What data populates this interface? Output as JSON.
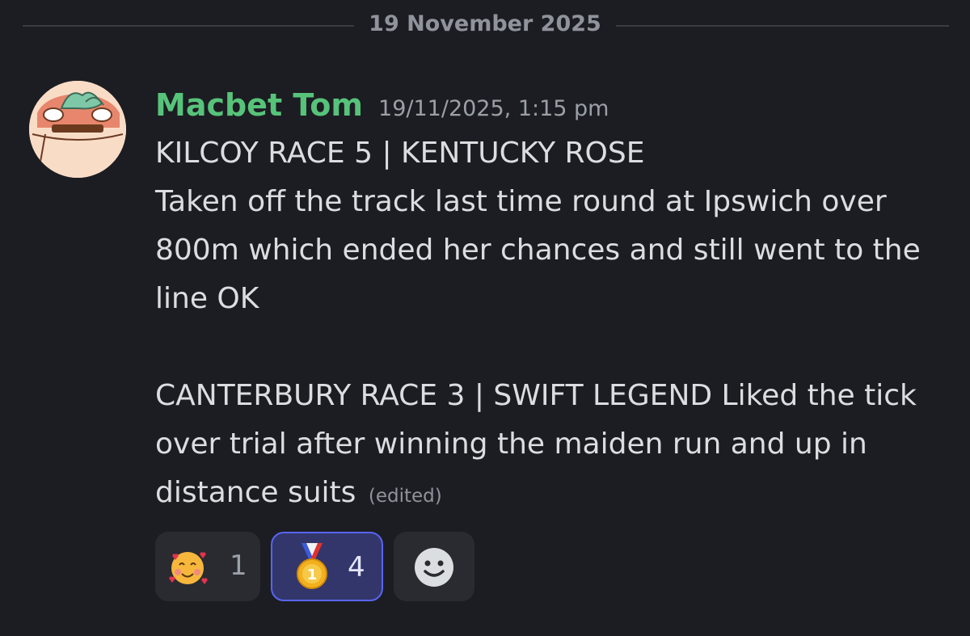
{
  "date_divider": "19 November 2025",
  "message": {
    "author": "Macbet Tom",
    "author_color": "#57c37a",
    "timestamp": "19/11/2025, 1:15 pm",
    "lines": [
      "KILCOY RACE 5 | KENTUCKY ROSE",
      "Taken off the track last time round at Ipswich over 800m which ended her chances and still went to the line OK"
    ],
    "paragraph2": "CANTERBURY RACE 3 | SWIFT LEGEND Liked the tick over trial after winning the maiden run and up in distance suits",
    "edited_label": "(edited)"
  },
  "reactions": [
    {
      "emoji": "smiling-face-with-hearts-icon",
      "count": "1",
      "selected": false
    },
    {
      "emoji": "first-place-medal-icon",
      "count": "4",
      "selected": true
    }
  ],
  "add_reaction_icon": "add-reaction-smile-icon",
  "accent_color": "#5865f2"
}
